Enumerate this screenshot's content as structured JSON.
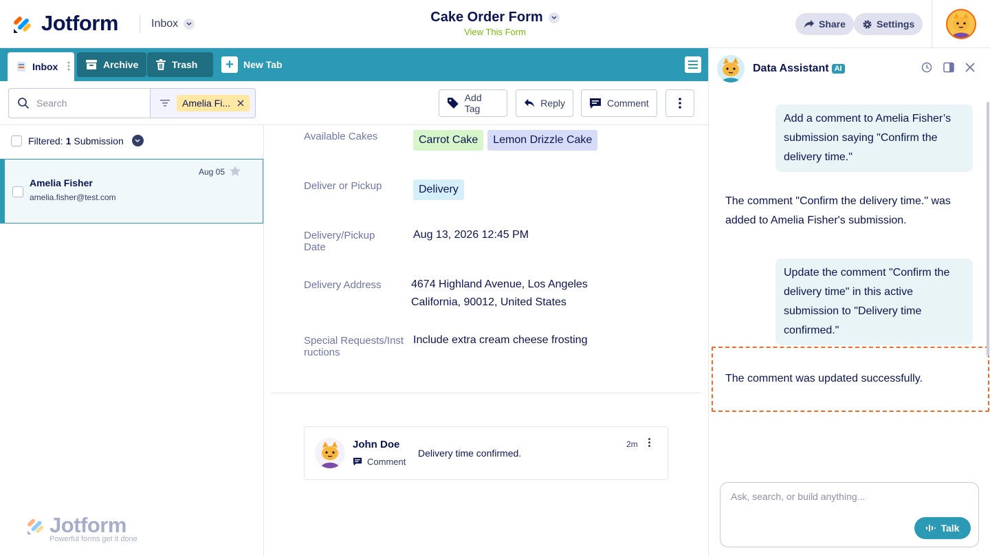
{
  "header": {
    "brand": "Jotform",
    "inbox_label": "Inbox",
    "form_title": "Cake Order Form",
    "view_form": "View This Form",
    "share_label": "Share",
    "settings_label": "Settings"
  },
  "tabs": [
    {
      "label": "Inbox",
      "active": true
    },
    {
      "label": "Archive",
      "active": false
    },
    {
      "label": "Trash",
      "active": false
    },
    {
      "label": "New Tab",
      "active": false
    }
  ],
  "toolbar": {
    "search_placeholder": "Search",
    "filter_chip": "Amelia Fi...",
    "add_tag": "Add Tag",
    "reply": "Reply",
    "comment": "Comment"
  },
  "list": {
    "filtered_prefix": "Filtered:",
    "filtered_count": "1",
    "filtered_suffix": "Submission",
    "submission": {
      "name": "Amelia Fisher",
      "email": "amelia.fisher@test.com",
      "date": "Aug 05"
    }
  },
  "watermark": {
    "brand": "Jotform",
    "tagline": "Powerful forms get it done"
  },
  "fields": [
    {
      "label": "Available Cakes",
      "tags": [
        "Carrot Cake",
        "Lemon Drizzle Cake"
      ]
    },
    {
      "label": "Deliver or Pickup",
      "tags": [
        "Delivery"
      ]
    },
    {
      "label": "Delivery/Pickup Date",
      "value": "Aug 13, 2026 12:45 PM"
    },
    {
      "label": "Delivery Address",
      "value_line1": "4674 Highland Avenue, Los Angeles",
      "value_line2": "California, 90012, United States"
    },
    {
      "label": "Special Requests/Instructions",
      "value": "Include extra cream cheese frosting"
    }
  ],
  "comment": {
    "author": "John Doe",
    "type": "Comment",
    "text": "Delivery time confirmed.",
    "time": "2m"
  },
  "assistant": {
    "title": "Data Assistant",
    "badge": "AI",
    "messages": [
      {
        "role": "user",
        "text": "Add a comment to Amelia Fisher’s submission saying \"Confirm the delivery time.\""
      },
      {
        "role": "assistant",
        "text": "The comment \"Confirm the delivery time.\" was added to Amelia Fisher's submission."
      },
      {
        "role": "user",
        "text": "Update the comment \"Confirm the delivery time\" in this active submission to \"Delivery time confirmed.\""
      },
      {
        "role": "assistant",
        "text": "The comment was updated successfully."
      }
    ],
    "input_placeholder": "Ask, search, or build anything...",
    "talk_label": "Talk"
  },
  "colors": {
    "accent": "#2d9ab5",
    "navy": "#0a1551",
    "highlight": "#f26b22",
    "view_link": "#78bb07"
  }
}
